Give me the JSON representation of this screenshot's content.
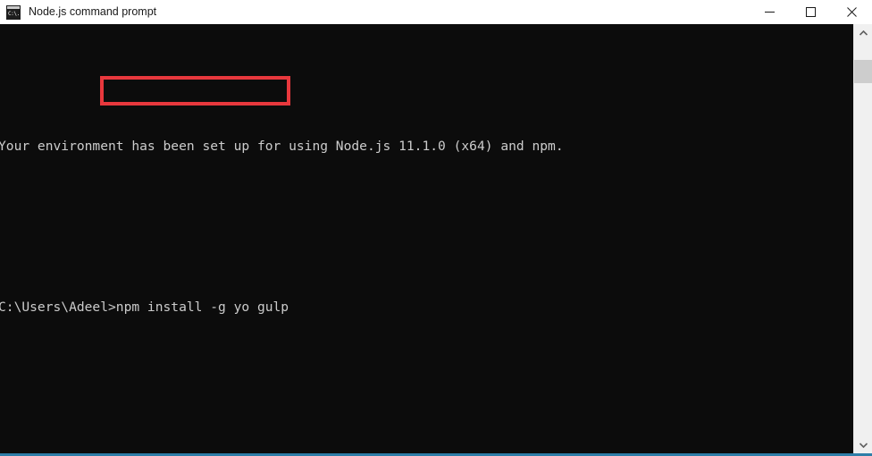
{
  "window": {
    "title": "Node.js command prompt",
    "icon": "console-icon",
    "icon_glyph": "C:\\.",
    "accent_color": "#2e7ea8",
    "titlebar_bg": "#ffffff",
    "terminal_bg": "#0c0c0c",
    "terminal_fg": "#cccccc"
  },
  "titlebar_buttons": {
    "minimize": "minimize-button",
    "maximize": "maximize-button",
    "close": "close-button"
  },
  "terminal": {
    "lines": [
      "Your environment has been set up for using Node.js 11.1.0 (x64) and npm.",
      "",
      "C:\\Users\\Adeel>npm install -g yo gulp"
    ],
    "prompt": "C:\\Users\\Adeel>",
    "command": "npm install -g yo gulp",
    "node_version": "11.1.0",
    "architecture": "x64"
  },
  "annotation": {
    "label": "command-highlight",
    "color": "#e8383d",
    "target_text": "npm install -g yo gulp"
  },
  "scrollbar": {
    "up_arrow": "scroll-up-arrow",
    "down_arrow": "scroll-down-arrow",
    "thumb": "scroll-thumb"
  }
}
